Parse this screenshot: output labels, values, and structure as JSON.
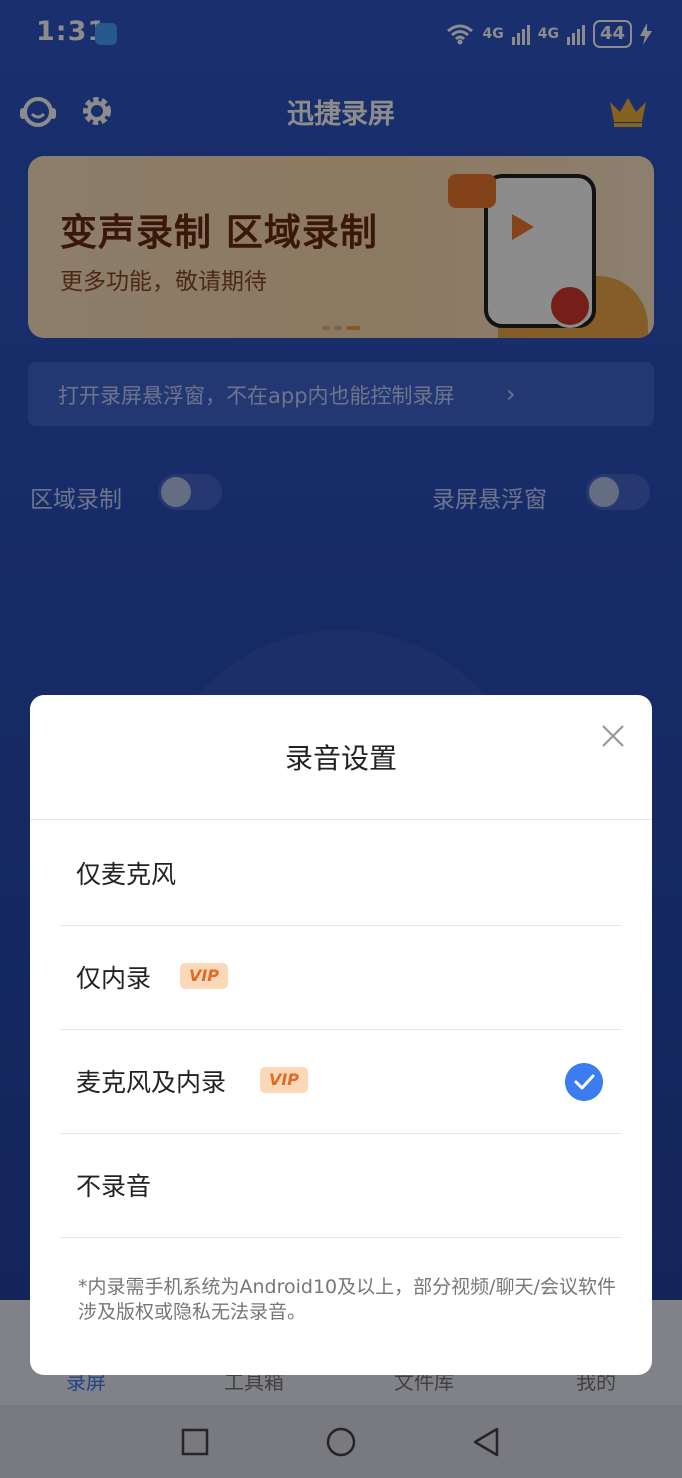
{
  "status_bar": {
    "time": "1:31",
    "network1": "4G",
    "network2": "4G",
    "battery": "44"
  },
  "header": {
    "title": "迅捷录屏",
    "support_icon": "customer-service-icon",
    "settings_icon": "gear-icon",
    "vip_icon": "crown-icon"
  },
  "banner": {
    "title": "变声录制 区域录制",
    "subtitle": "更多功能，敬请期待"
  },
  "float_tip": {
    "text": "打开录屏悬浮窗，不在app内也能控制录屏"
  },
  "toggles": {
    "region_label": "区域录制",
    "float_label": "录屏悬浮窗",
    "region_on": false,
    "float_on": false
  },
  "bottom_nav": {
    "items": [
      "录屏",
      "工具箱",
      "文件库",
      "我的"
    ]
  },
  "dialog": {
    "title": "录音设置",
    "options": [
      {
        "label": "仅麦克风",
        "vip": false,
        "selected": false
      },
      {
        "label": "仅内录",
        "vip": true,
        "selected": false
      },
      {
        "label": "麦克风及内录",
        "vip": true,
        "selected": true
      },
      {
        "label": "不录音",
        "vip": false,
        "selected": false
      }
    ],
    "vip_badge": "VIP",
    "note": "*内录需手机系统为Android10及以上，部分视频/聊天/会议软件涉及版权或隐私无法录音。"
  },
  "colors": {
    "accent": "#3b7cf0",
    "vip_bg": "#fbd8b8",
    "vip_text": "#e06b2a",
    "app_bg": "#2f57c9"
  }
}
